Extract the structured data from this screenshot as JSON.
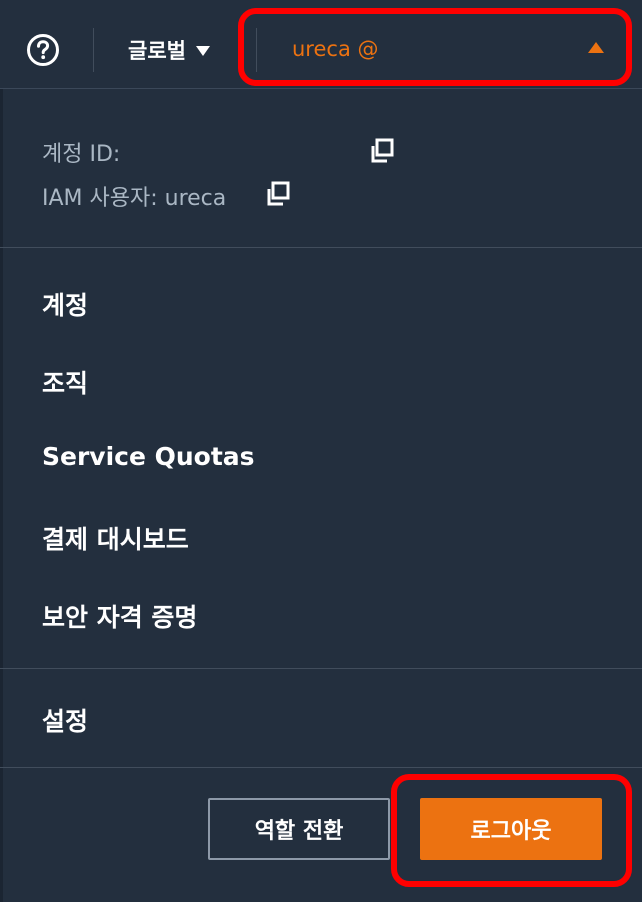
{
  "topbar": {
    "help_icon": "help-circle-icon",
    "region_label": "글로벌",
    "region_caret_icon": "caret-down-icon",
    "account_label": "ureca @",
    "account_caret_icon": "caret-up-icon"
  },
  "account_info": {
    "account_id_label": "계정 ID:",
    "iam_user_label": "IAM 사용자: ureca",
    "copy_icon": "copy-icon"
  },
  "menu": {
    "items": [
      {
        "label": "계정"
      },
      {
        "label": "조직"
      },
      {
        "label": "Service Quotas"
      },
      {
        "label": "결제 대시보드"
      },
      {
        "label": "보안 자격 증명"
      }
    ],
    "settings_label": "설정"
  },
  "actions": {
    "switch_role_label": "역할 전환",
    "logout_label": "로그아웃"
  },
  "colors": {
    "background": "#232f3e",
    "accent_orange": "#ec7211",
    "highlight_red": "#ff0000",
    "muted_text": "#aab7c4",
    "divider": "#414d5c"
  }
}
